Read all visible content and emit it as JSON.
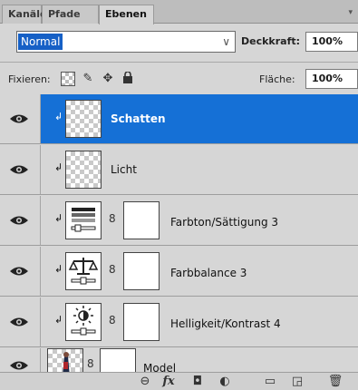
{
  "tabs": [
    {
      "label": "Kanäle"
    },
    {
      "label": "Pfade"
    },
    {
      "label": "Ebenen"
    }
  ],
  "blend": {
    "mode": "Normal",
    "opacity_label": "Deckkraft:",
    "opacity_value": "100%"
  },
  "lock": {
    "label": "Fixieren:",
    "fill_label": "Fläche:",
    "fill_value": "100%"
  },
  "layers": [
    {
      "name": "Schatten",
      "selected": true,
      "thumb": "checker"
    },
    {
      "name": "Licht",
      "selected": false,
      "thumb": "checker"
    },
    {
      "name": "Farbton/Sättigung 3",
      "selected": false,
      "thumb": "hue-saturation-icon"
    },
    {
      "name": "Farbbalance 3",
      "selected": false,
      "thumb": "color-balance-icon"
    },
    {
      "name": "Helligkeit/Kontrast 4",
      "selected": false,
      "thumb": "brightness-contrast-icon"
    },
    {
      "name": "Model",
      "selected": false,
      "thumb": "photo"
    }
  ],
  "colors": {
    "selection": "#1570d6",
    "panel": "#d6d6d6"
  }
}
